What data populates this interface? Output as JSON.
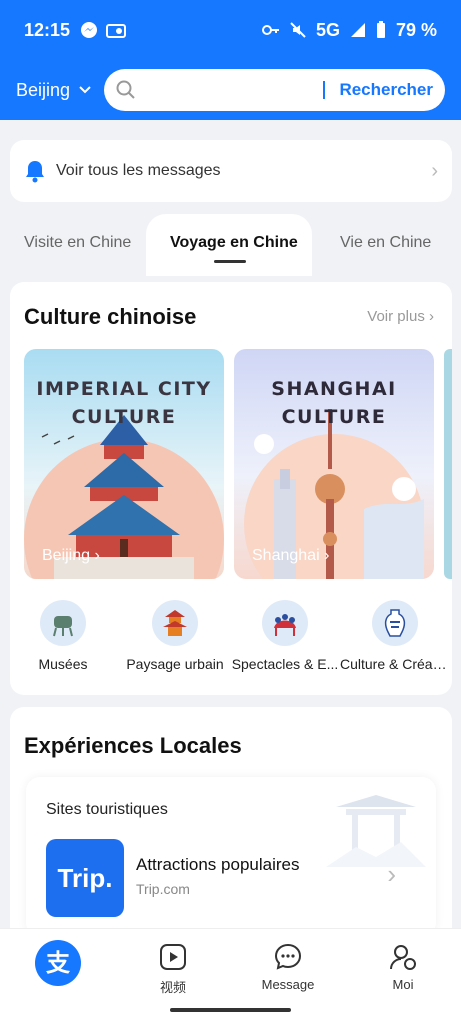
{
  "status": {
    "time": "12:15",
    "network": "5G",
    "battery": "79 %"
  },
  "header": {
    "city": "Beijing",
    "search_button": "Rechercher",
    "search_placeholder": ""
  },
  "messages": {
    "label": "Voir tous les messages"
  },
  "tabs": [
    {
      "label": "Visite en Chine",
      "active": false
    },
    {
      "label": "Voyage en Chine",
      "active": true
    },
    {
      "label": "Vie en Chine",
      "active": false
    }
  ],
  "culture": {
    "title": "Culture chinoise",
    "more": "Voir plus",
    "cards": [
      {
        "title_line1": "IMPERIAL CITY",
        "title_line2": "CULTURE",
        "city": "Beijing ›"
      },
      {
        "title_line1": "SHANGHAI",
        "title_line2": "CULTURE",
        "city": "Shanghai ›"
      }
    ],
    "categories": [
      {
        "label": "Musées",
        "icon": "bronze-vessel-icon"
      },
      {
        "label": "Paysage urbain",
        "icon": "pagoda-icon"
      },
      {
        "label": "Spectacles & E...",
        "icon": "opera-crown-icon"
      },
      {
        "label": "Culture & Créati...",
        "icon": "porcelain-vase-icon"
      }
    ]
  },
  "local": {
    "title": "Expériences Locales",
    "subsection": "Sites touristiques",
    "item": {
      "logo": "Trip.",
      "title": "Attractions populaires",
      "source": "Trip.com"
    }
  },
  "bottom_nav": [
    {
      "label": "",
      "icon": "alipay-icon"
    },
    {
      "label": "视频",
      "icon": "video-icon"
    },
    {
      "label": "Message",
      "icon": "message-icon"
    },
    {
      "label": "Moi",
      "icon": "profile-icon"
    }
  ],
  "colors": {
    "brand": "#1677ff",
    "background": "#f0f2f5"
  }
}
